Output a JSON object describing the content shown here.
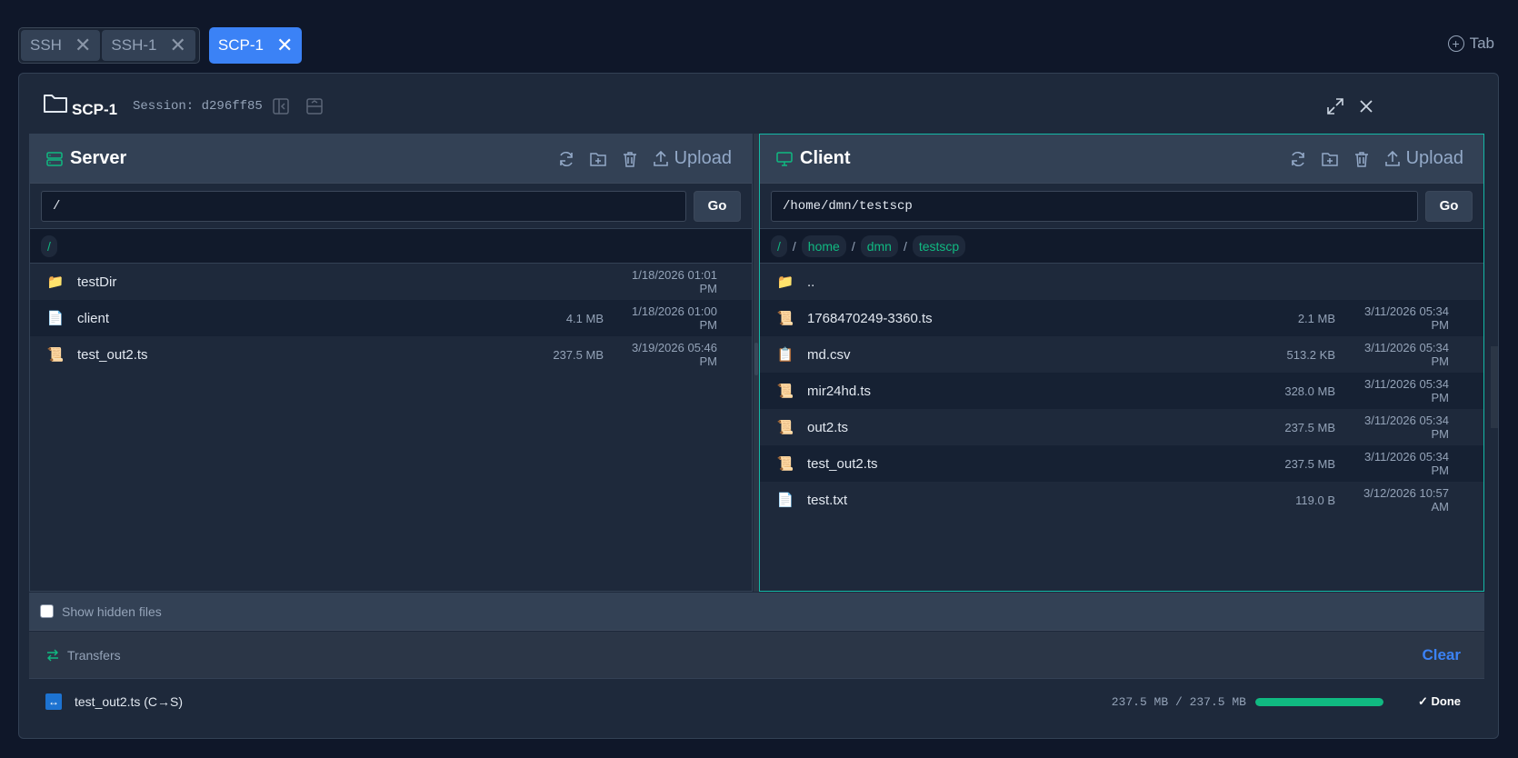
{
  "tabs": [
    {
      "label": "SSH"
    },
    {
      "label": "SSH-1"
    },
    {
      "label": "SCP-1"
    }
  ],
  "add_tab_label": "Tab",
  "window": {
    "title": "SCP-1",
    "session": "Session: d296ff85"
  },
  "server": {
    "title": "Server",
    "upload_label": "Upload",
    "path": "/",
    "go_label": "Go",
    "breadcrumbs": [
      "/"
    ],
    "files": [
      {
        "name": "testDir",
        "size": "",
        "date": "1/18/2026 01:01 PM",
        "icon": "folder-icon"
      },
      {
        "name": "client",
        "size": "4.1 MB",
        "date": "1/18/2026 01:00 PM",
        "icon": "file-icon"
      },
      {
        "name": "test_out2.ts",
        "size": "237.5 MB",
        "date": "3/19/2026 05:46 PM",
        "icon": "script-icon"
      }
    ]
  },
  "client": {
    "title": "Client",
    "upload_label": "Upload",
    "path": "/home/dmn/testscp",
    "go_label": "Go",
    "breadcrumbs": [
      "/",
      "home",
      "dmn",
      "testscp"
    ],
    "files": [
      {
        "name": "..",
        "size": "",
        "date": "",
        "icon": "folder-icon"
      },
      {
        "name": "1768470249-3360.ts",
        "size": "2.1 MB",
        "date": "3/11/2026 05:34 PM",
        "icon": "script-icon"
      },
      {
        "name": "md.csv",
        "size": "513.2 KB",
        "date": "3/11/2026 05:34 PM",
        "icon": "clipboard-icon"
      },
      {
        "name": "mir24hd.ts",
        "size": "328.0 MB",
        "date": "3/11/2026 05:34 PM",
        "icon": "script-icon"
      },
      {
        "name": "out2.ts",
        "size": "237.5 MB",
        "date": "3/11/2026 05:34 PM",
        "icon": "script-icon"
      },
      {
        "name": "test_out2.ts",
        "size": "237.5 MB",
        "date": "3/11/2026 05:34 PM",
        "icon": "script-icon"
      },
      {
        "name": "test.txt",
        "size": "119.0 B",
        "date": "3/12/2026 10:57 AM",
        "icon": "file-icon"
      }
    ]
  },
  "show_hidden_label": "Show hidden files",
  "transfers": {
    "title": "Transfers",
    "clear_label": "Clear",
    "items": [
      {
        "name": "test_out2.ts (C→S)",
        "progress": "237.5 MB / 237.5 MB",
        "fraction": 1.0,
        "status": "✓ Done"
      }
    ]
  },
  "colors": {
    "accent": "#3b82f6",
    "teal": "#14b8a6",
    "green": "#10b981",
    "bg": "#0f1729",
    "panel": "#1e293b"
  }
}
